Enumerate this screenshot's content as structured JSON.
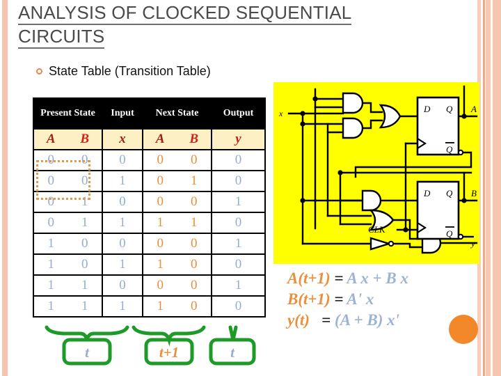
{
  "slide": {
    "title": "ANALYSIS OF CLOCKED SEQUENTIAL CIRCUITS",
    "bullet": "State Table (Transition Table)"
  },
  "table": {
    "headers": [
      "Present State",
      "Input",
      "Next State",
      "Output"
    ],
    "variables": {
      "present_a": "A",
      "present_b": "B",
      "input_x": "x",
      "next_a": "A",
      "next_b": "B",
      "output_y": "y"
    },
    "rows": [
      {
        "A": "0",
        "B": "0",
        "x": "0",
        "nA": "0",
        "nB": "0",
        "y": "0"
      },
      {
        "A": "0",
        "B": "0",
        "x": "1",
        "nA": "0",
        "nB": "1",
        "y": "0"
      },
      {
        "A": "0",
        "B": "1",
        "x": "0",
        "nA": "0",
        "nB": "0",
        "y": "1"
      },
      {
        "A": "0",
        "B": "1",
        "x": "1",
        "nA": "1",
        "nB": "1",
        "y": "0"
      },
      {
        "A": "1",
        "B": "0",
        "x": "0",
        "nA": "0",
        "nB": "0",
        "y": "1"
      },
      {
        "A": "1",
        "B": "0",
        "x": "1",
        "nA": "1",
        "nB": "0",
        "y": "0"
      },
      {
        "A": "1",
        "B": "1",
        "x": "0",
        "nA": "0",
        "nB": "0",
        "y": "1"
      },
      {
        "A": "1",
        "B": "1",
        "x": "1",
        "nA": "1",
        "nB": "0",
        "y": "0"
      }
    ]
  },
  "time_labels": {
    "present": "t",
    "next": "t+1",
    "output": "t"
  },
  "equations": [
    {
      "lhs": "A(t+1)",
      "eq": " = ",
      "rhs": "A x + B x"
    },
    {
      "lhs": "B(t+1)",
      "eq": " = ",
      "rhs": "A' x"
    },
    {
      "lhs": "y(t)",
      "eq": "   = ",
      "rhs": "(A + B) x'"
    }
  ],
  "circuit": {
    "input_label": "x",
    "clock_label": "CLK",
    "ff1": {
      "d": "D",
      "q": "Q",
      "qbar": "Q"
    },
    "ff2": {
      "d": "D",
      "q": "Q",
      "qbar": "Q"
    },
    "outputs": {
      "a": "A",
      "b": "B",
      "y": "y"
    }
  },
  "colors": {
    "accent_orange": "#e8903c",
    "value_blue": "#95aed0",
    "panel_yellow": "#ffff00",
    "brace_green": "#1d9a27",
    "header_black": "#000000",
    "var_row_cream": "#fdf0c4",
    "stripe_peach": "#f7c3ae"
  }
}
